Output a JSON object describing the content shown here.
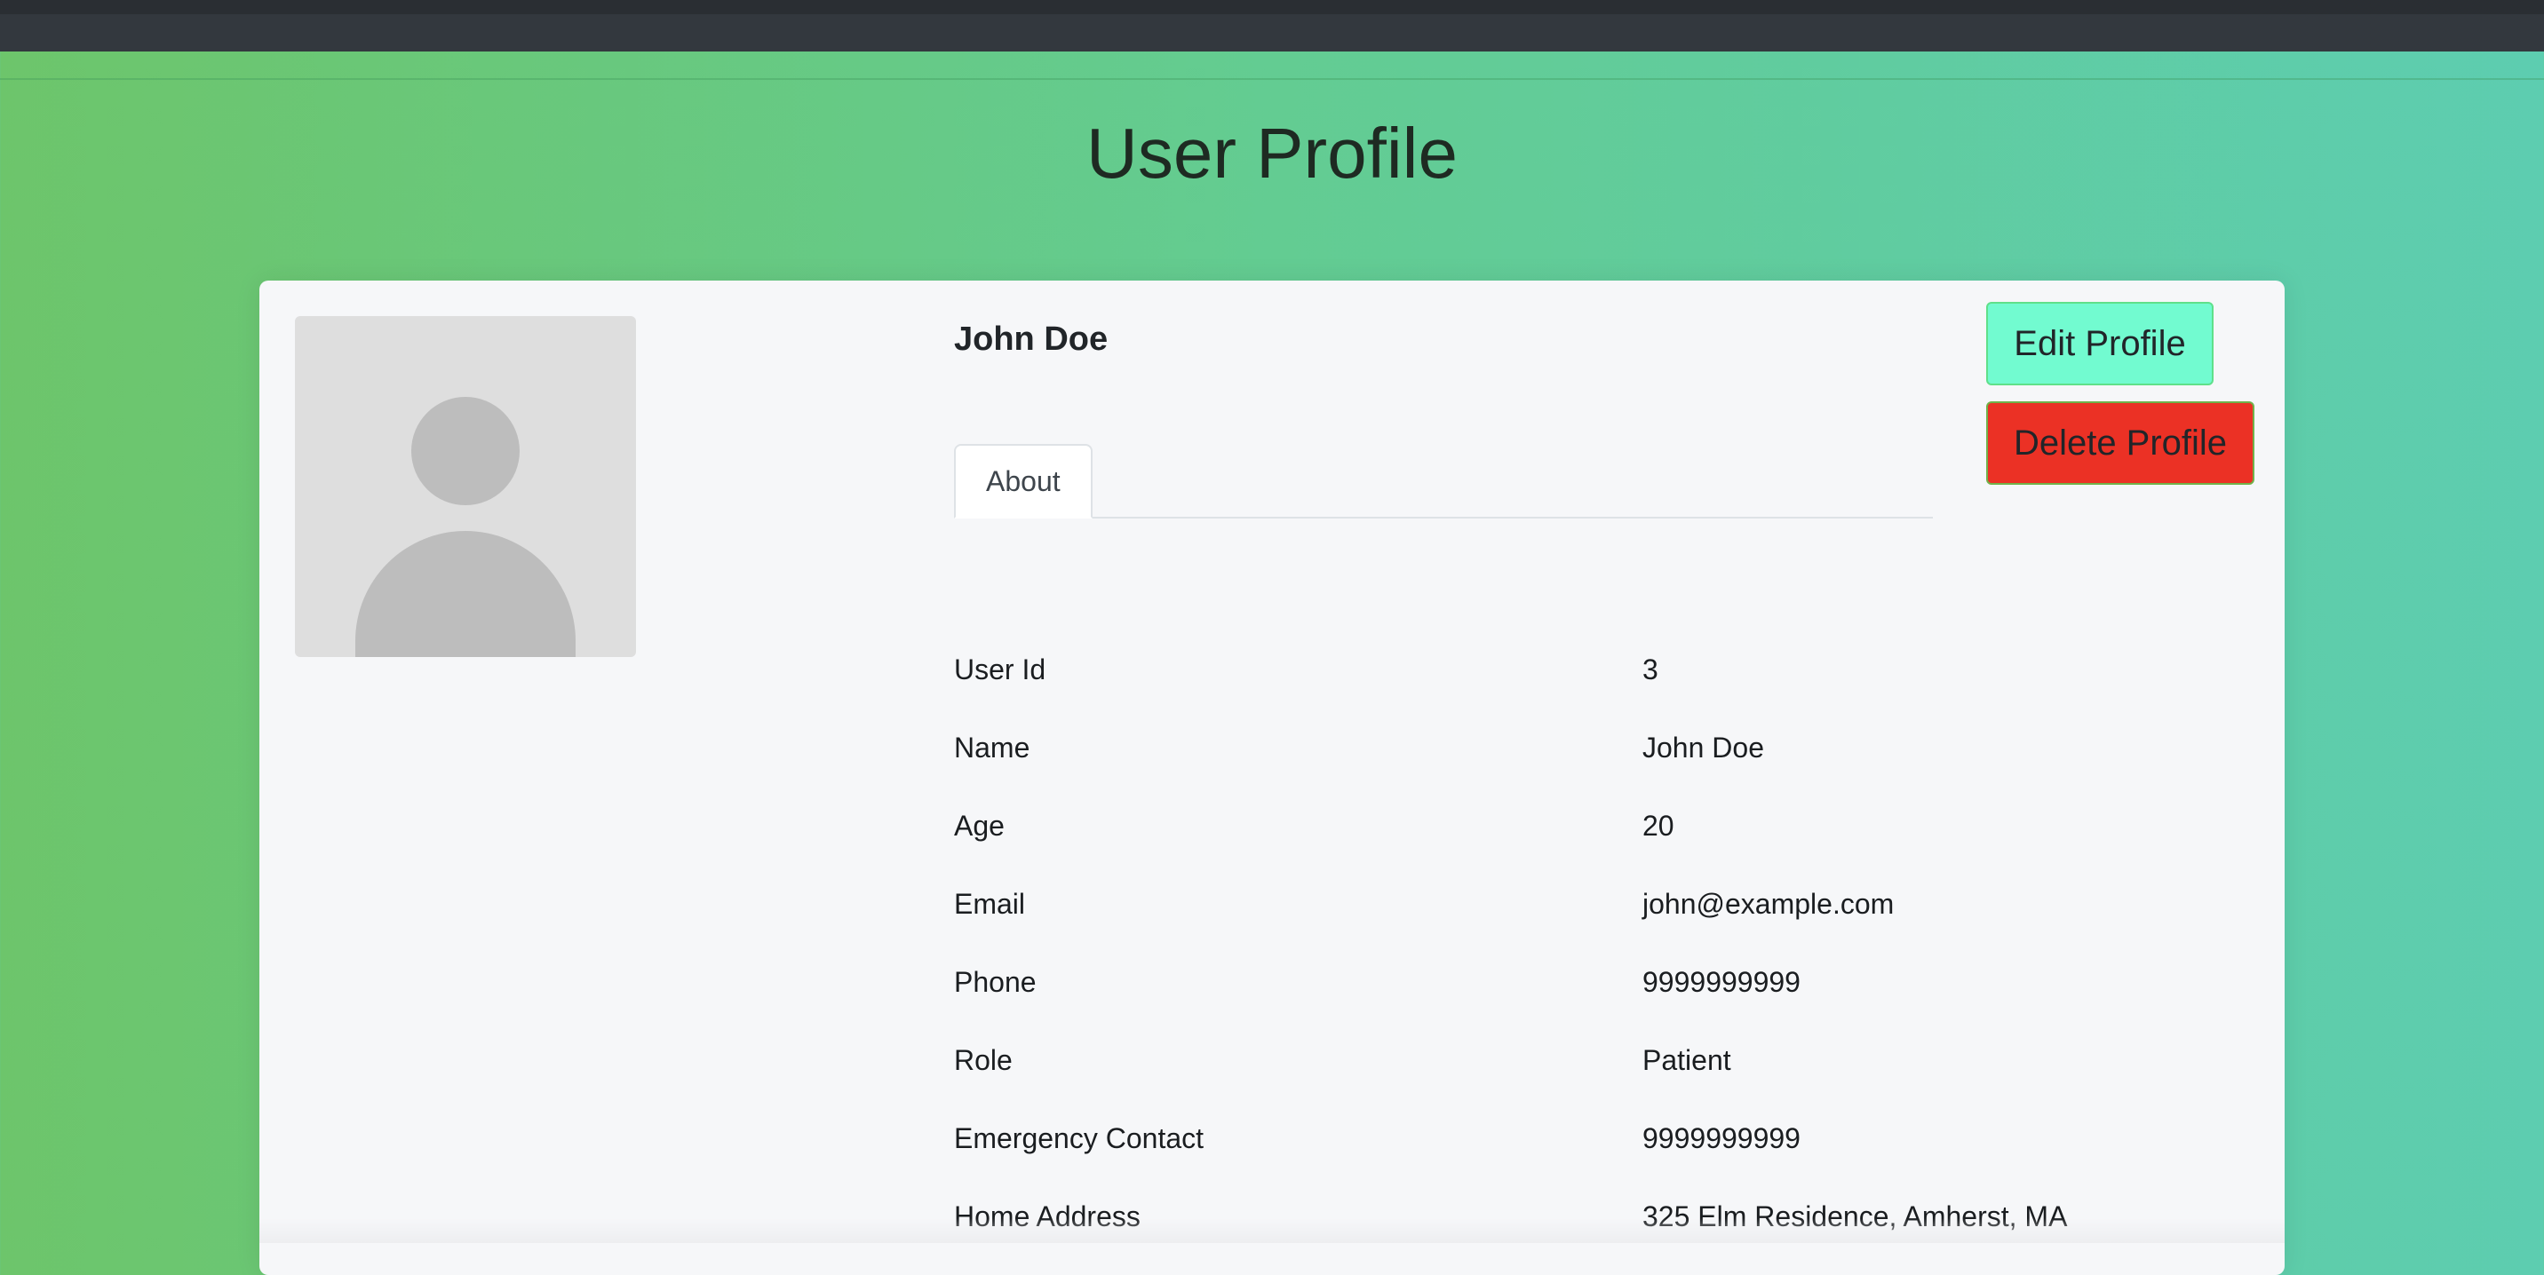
{
  "page": {
    "title": "User Profile"
  },
  "profile": {
    "display_name": "John Doe",
    "tabs": [
      {
        "label": "About"
      }
    ],
    "actions": {
      "edit_label": "Edit Profile",
      "delete_label": "Delete Profile"
    },
    "details": [
      {
        "label": "User Id",
        "value": "3"
      },
      {
        "label": "Name",
        "value": "John Doe"
      },
      {
        "label": "Age",
        "value": "20"
      },
      {
        "label": "Email",
        "value": "john@example.com"
      },
      {
        "label": "Phone",
        "value": "9999999999"
      },
      {
        "label": "Role",
        "value": "Patient"
      },
      {
        "label": "Emergency Contact",
        "value": "9999999999"
      },
      {
        "label": "Home Address",
        "value": "325 Elm Residence, Amherst, MA"
      }
    ]
  },
  "colors": {
    "edit_button": "#72fbd0",
    "delete_button": "#eb3125",
    "background_start": "#6dc56b",
    "background_end": "#5dcdb0"
  },
  "icons": {
    "avatar": "user-placeholder-icon"
  }
}
